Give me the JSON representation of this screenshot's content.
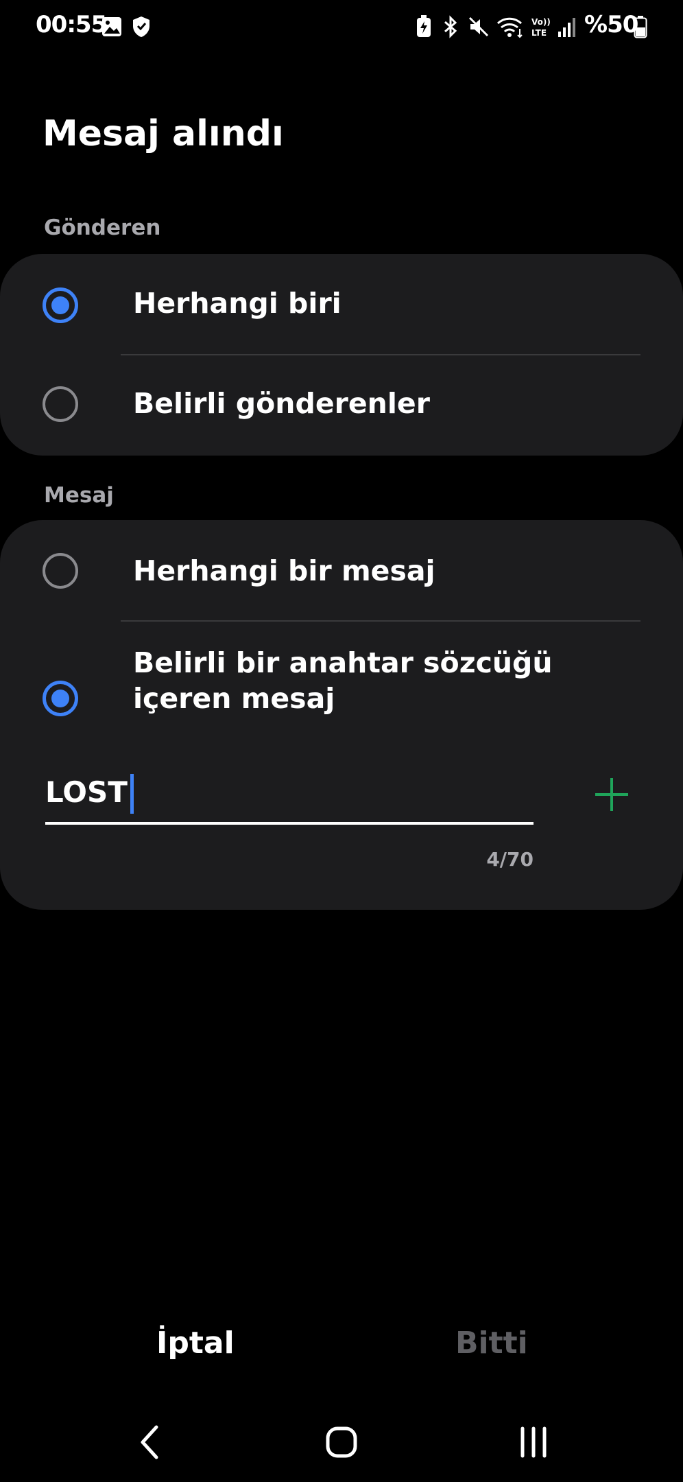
{
  "status_bar": {
    "time": "00:55",
    "battery_text": "%50",
    "icons": [
      "gallery-icon",
      "shield-icon",
      "battery-saver-icon",
      "bluetooth-icon",
      "mute-icon",
      "wifi-icon",
      "volte-icon",
      "signal-icon",
      "battery-icon"
    ]
  },
  "page": {
    "title": "Mesaj alındı"
  },
  "sender_section": {
    "label": "Gönderen",
    "options": [
      {
        "label": "Herhangi biri",
        "checked": true
      },
      {
        "label": "Belirli gönderenler",
        "checked": false
      }
    ]
  },
  "message_section": {
    "label": "Mesaj",
    "options": [
      {
        "label": "Herhangi bir mesaj",
        "checked": false
      },
      {
        "label": "Belirli bir anahtar sözcüğü içeren mesaj",
        "checked": true
      }
    ],
    "keyword": {
      "value": "LOST",
      "counter": "4/70"
    }
  },
  "actions": {
    "cancel_label": "İptal",
    "done_label": "Bitti"
  },
  "colors": {
    "accent": "#3e82f7",
    "add_icon": "#1fa45a",
    "card": "#1c1c1e",
    "disabled_text": "#5f5f63"
  },
  "nav": {
    "icons": [
      "back-icon",
      "home-icon",
      "recents-icon"
    ]
  }
}
